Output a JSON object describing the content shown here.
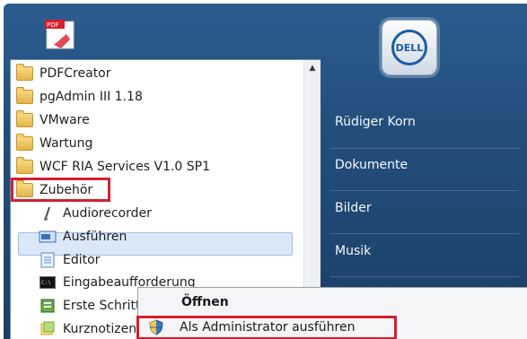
{
  "programs": {
    "items": [
      {
        "label": "PDFCreator",
        "icon": "folder-icon"
      },
      {
        "label": "pgAdmin III 1.18",
        "icon": "folder-icon"
      },
      {
        "label": "VMware",
        "icon": "folder-icon"
      },
      {
        "label": "Wartung",
        "icon": "folder-icon"
      },
      {
        "label": "WCF RIA Services V1.0 SP1",
        "icon": "folder-icon"
      },
      {
        "label": "Zubehör",
        "icon": "folder-icon"
      },
      {
        "label": "Audiorecorder",
        "icon": "microphone-icon"
      },
      {
        "label": "Ausführen",
        "icon": "run-icon"
      },
      {
        "label": "Editor",
        "icon": "notepad-icon"
      },
      {
        "label": "Eingabeaufforderung",
        "icon": "cmd-icon"
      },
      {
        "label": "Erste Schritte",
        "icon": "getting-started-icon"
      },
      {
        "label": "Kurznotizen",
        "icon": "sticky-notes-icon"
      }
    ]
  },
  "right_panel": {
    "links": [
      "Rüdiger Korn",
      "Dokumente",
      "Bilder",
      "Musik"
    ],
    "badge_text": "DELL"
  },
  "context_menu": {
    "open_label": "Öffnen",
    "run_as_admin_label": "Als Administrator ausführen"
  },
  "pinned_icon_label": "PDF",
  "colors": {
    "highlight_red": "#d2202f",
    "start_menu_blue": "#234f7d",
    "selection_blue": "#dbe8f8"
  }
}
